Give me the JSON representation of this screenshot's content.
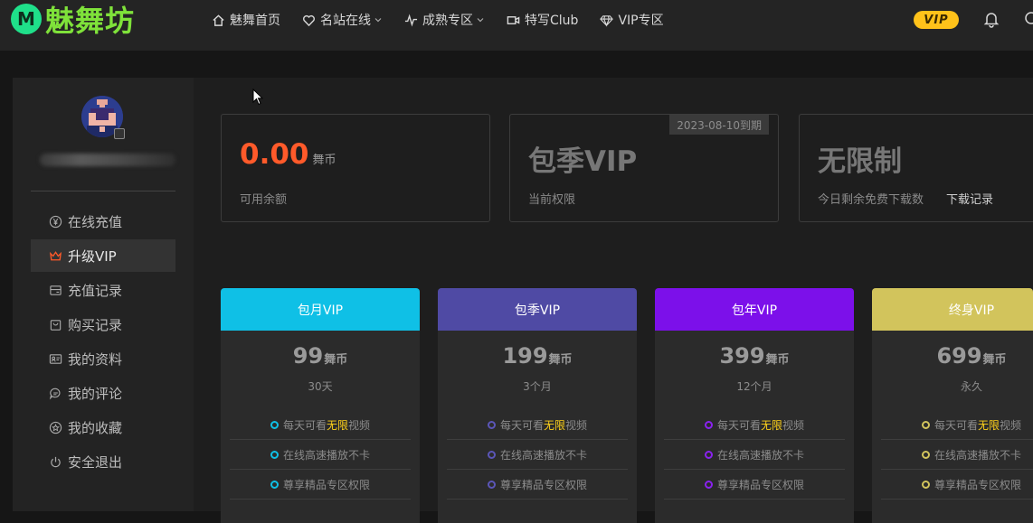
{
  "header": {
    "logo_letter": "M",
    "logo_text": "魅舞坊",
    "nav": [
      {
        "label": "魅舞首页",
        "icon": "home-icon",
        "dropdown": false
      },
      {
        "label": "名站在线",
        "icon": "heart-icon",
        "dropdown": true
      },
      {
        "label": "成熟专区",
        "icon": "pulse-icon",
        "dropdown": true
      },
      {
        "label": "特写Club",
        "icon": "video-icon",
        "dropdown": false
      },
      {
        "label": "VIP专区",
        "icon": "diamond-icon",
        "dropdown": false
      }
    ],
    "vip_badge": "VIP"
  },
  "sidebar": {
    "menu": [
      {
        "label": "在线充值",
        "icon": "yen-circle-icon",
        "active": false
      },
      {
        "label": "升级VIP",
        "icon": "crown-icon",
        "active": true
      },
      {
        "label": "充值记录",
        "icon": "wallet-icon",
        "active": false
      },
      {
        "label": "购买记录",
        "icon": "shopping-bag-icon",
        "active": false
      },
      {
        "label": "我的资料",
        "icon": "id-card-icon",
        "active": false
      },
      {
        "label": "我的评论",
        "icon": "comment-icon",
        "active": false
      },
      {
        "label": "我的收藏",
        "icon": "star-circle-icon",
        "active": false
      },
      {
        "label": "安全退出",
        "icon": "power-icon",
        "active": false
      }
    ]
  },
  "stats": {
    "balance": {
      "value": "0.00",
      "unit": "舞币",
      "label": "可用余额"
    },
    "permission": {
      "value": "包季VIP",
      "label": "当前权限",
      "expire": "2023-08-10到期"
    },
    "downloads": {
      "value": "无限制",
      "label": "今日剩余免费下载数",
      "link": "下载记录"
    }
  },
  "plans": [
    {
      "name": "包月VIP",
      "price": "99",
      "unit": "舞币",
      "duration": "30天",
      "color": "#0fc0e6"
    },
    {
      "name": "包季VIP",
      "price": "199",
      "unit": "舞币",
      "duration": "3个月",
      "color": "#4f4aa4"
    },
    {
      "name": "包年VIP",
      "price": "399",
      "unit": "舞币",
      "duration": "12个月",
      "color": "#7c10ea"
    },
    {
      "name": "终身VIP",
      "price": "699",
      "unit": "舞币",
      "duration": "永久",
      "color": "#d2c45c"
    }
  ],
  "features": {
    "f1_pre": "每天可看",
    "f1_hl": "无限",
    "f1_post": "视频",
    "f2": "在线高速播放不卡",
    "f3": "尊享精品专区权限"
  },
  "colors": {
    "accent_orange": "#ff5a2a",
    "vip_gold": "#ffc21a",
    "highlight": "#ffd21a"
  }
}
